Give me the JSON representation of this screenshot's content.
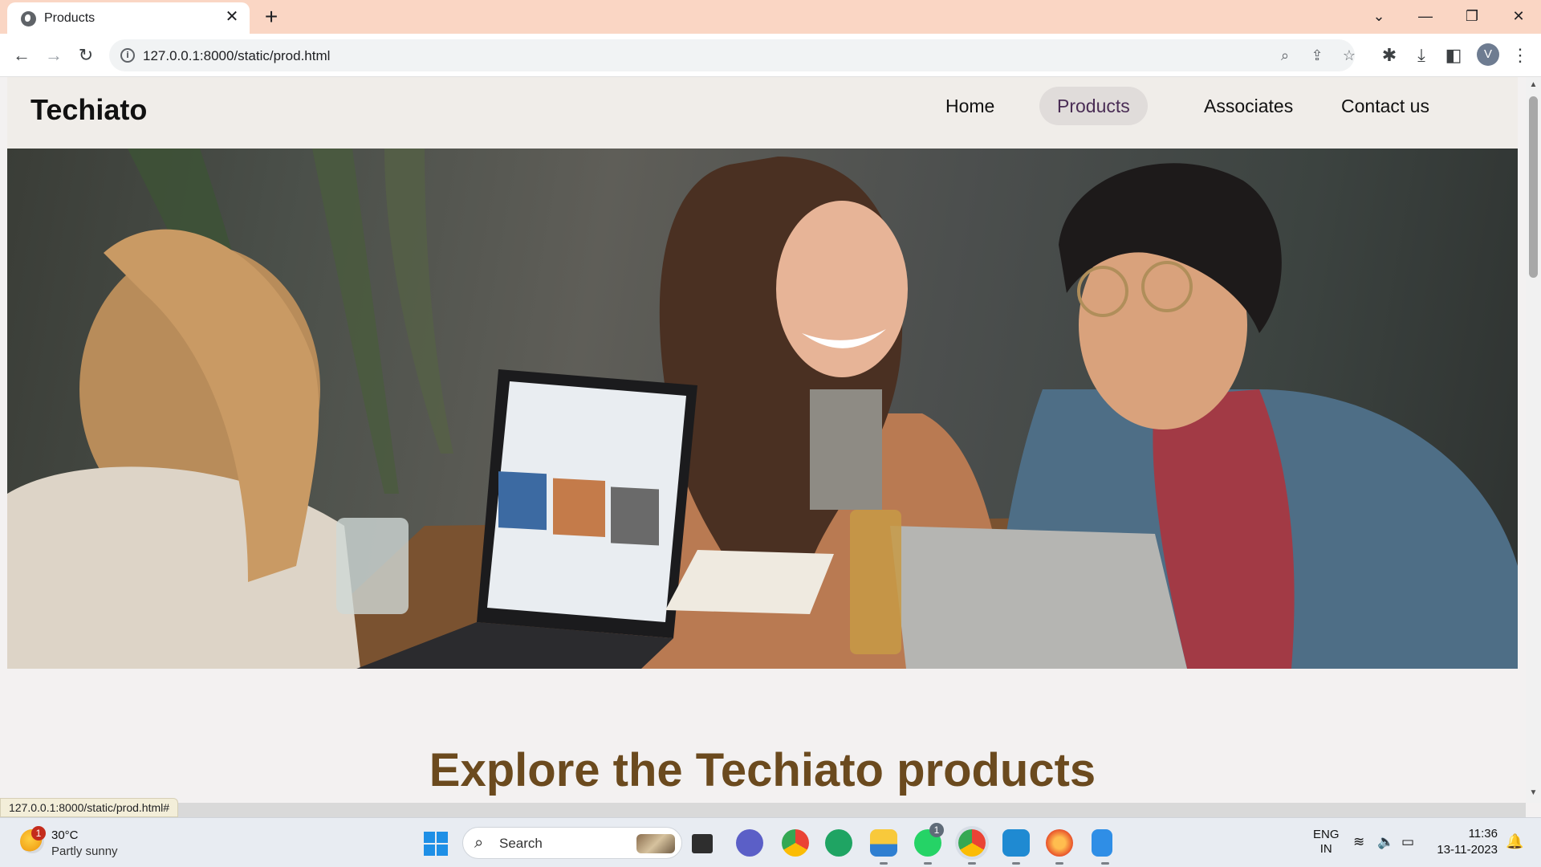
{
  "browser": {
    "tab_title": "Products",
    "url": "127.0.0.1:8000/static/prod.html",
    "hover_status_url": "127.0.0.1:8000/static/prod.html#",
    "profile_initial": "V"
  },
  "site": {
    "logo": "Techiato",
    "nav": [
      {
        "label": "Home",
        "active": false
      },
      {
        "label": "Products",
        "active": true
      },
      {
        "label": "Associates",
        "active": false
      },
      {
        "label": "Contact us",
        "active": false
      }
    ],
    "hero_image": "photo of three people laughing around laptops",
    "section_title": "Explore the Techiato products"
  },
  "taskbar": {
    "weather_temp": "30°C",
    "weather_desc": "Partly sunny",
    "weather_badge": "1",
    "search_placeholder": "Search",
    "whatsapp_badge": "1",
    "lang_line1": "ENG",
    "lang_line2": "IN",
    "time": "11:36",
    "date": "13-11-2023"
  },
  "colors": {
    "tab_strip": "#fad6c4",
    "section_title": "#6b4a1e",
    "nav_active_bg": "#e0dcda"
  }
}
